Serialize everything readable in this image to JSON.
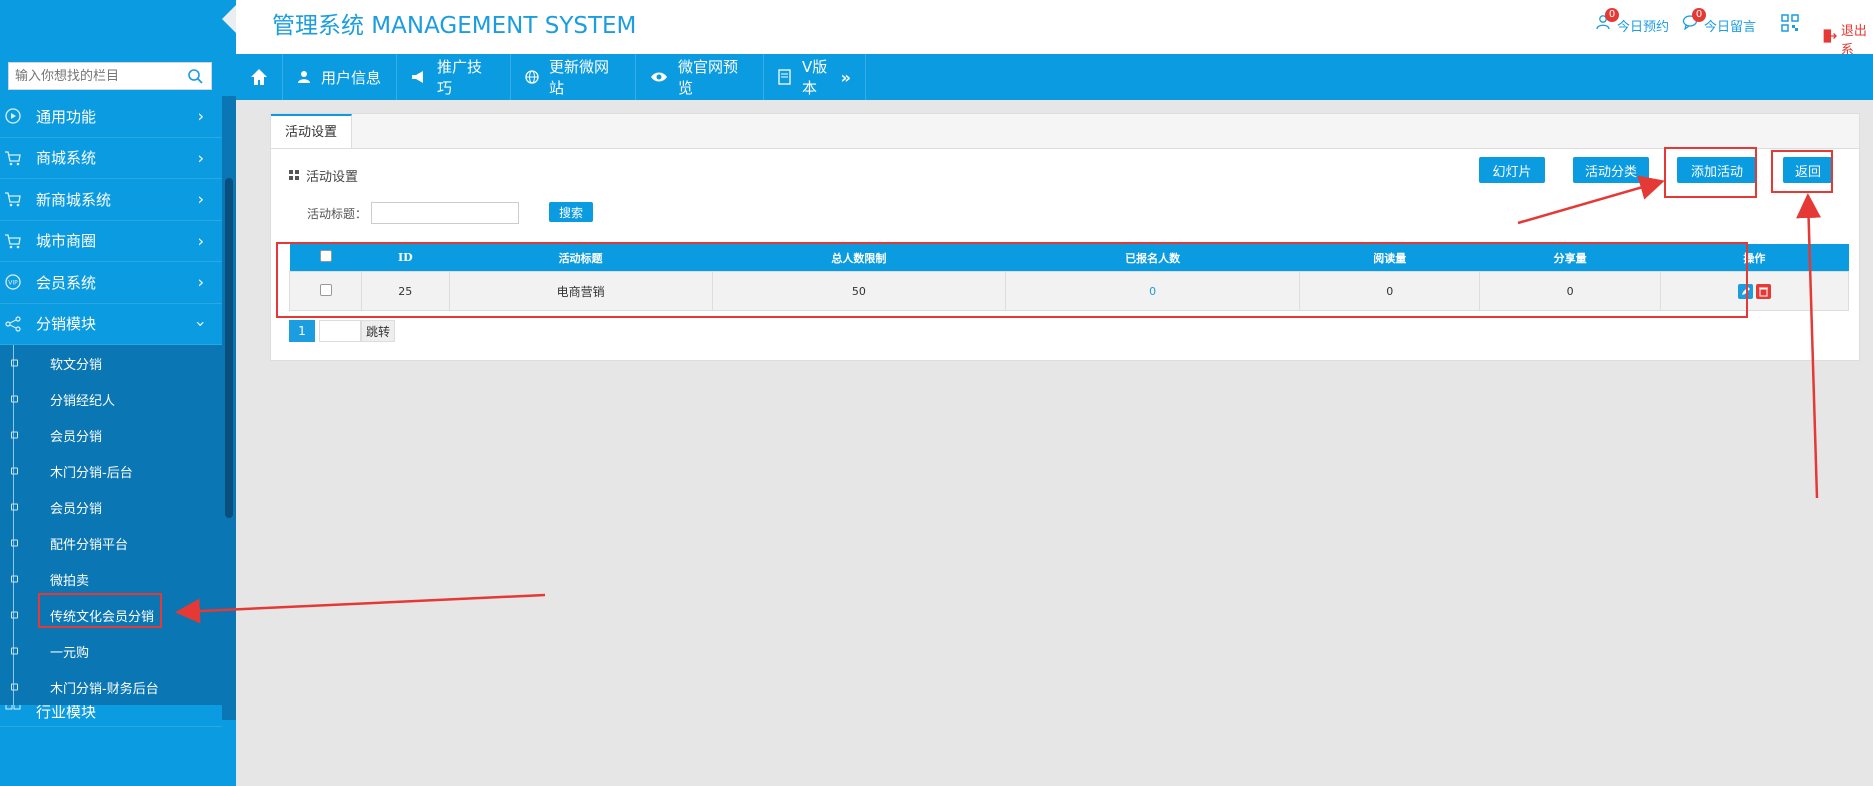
{
  "header": {
    "title": "管理系统 MANAGEMENT SYSTEM",
    "reservation_label": "今日预约",
    "reservation_count": "0",
    "message_label": "今日留言",
    "message_count": "0",
    "logout_label": "退出系",
    "accent": "#0b9be0",
    "alert": "#e53935"
  },
  "sidebar": {
    "search_placeholder": "输入你想找的栏目",
    "items": [
      {
        "label": "通用功能",
        "icon": "play-circle-icon"
      },
      {
        "label": "商城系统",
        "icon": "cart-icon"
      },
      {
        "label": "新商城系统",
        "icon": "cart-icon"
      },
      {
        "label": "城市商圈",
        "icon": "cart-icon"
      },
      {
        "label": "会员系统",
        "icon": "vip-icon"
      },
      {
        "label": "分销模块",
        "icon": "share-icon"
      }
    ],
    "submenu": [
      "软文分销",
      "分销经纪人",
      "会员分销",
      "木门分销-后台",
      "会员分销",
      "配件分销平台",
      "微拍卖",
      "传统文化会员分销",
      "一元购",
      "木门分销-财务后台"
    ],
    "next_item": "行业模块"
  },
  "navbar": {
    "items": [
      {
        "label": "用户信息",
        "icon": "user-icon"
      },
      {
        "label": "推广技巧",
        "icon": "megaphone-icon"
      },
      {
        "label": "更新微网站",
        "icon": "globe-icon"
      },
      {
        "label": "微官网预览",
        "icon": "eye-icon"
      },
      {
        "label": "V版本",
        "icon": "document-icon"
      }
    ]
  },
  "panel": {
    "tab": "活动设置",
    "section_title": "活动设置",
    "buttons": {
      "slides": "幻灯片",
      "category": "活动分类",
      "add": "添加活动",
      "back": "返回"
    },
    "filter_label": "活动标题：",
    "search_button": "搜索",
    "table": {
      "headers": [
        "ID",
        "活动标题",
        "总人数限制",
        "已报名人数",
        "阅读量",
        "分享量",
        "操作"
      ],
      "rows": [
        [
          "25",
          "电商营销",
          "50",
          "0",
          "0",
          "0"
        ]
      ]
    },
    "pager": {
      "current_page": "1",
      "go_label": "跳转"
    }
  }
}
